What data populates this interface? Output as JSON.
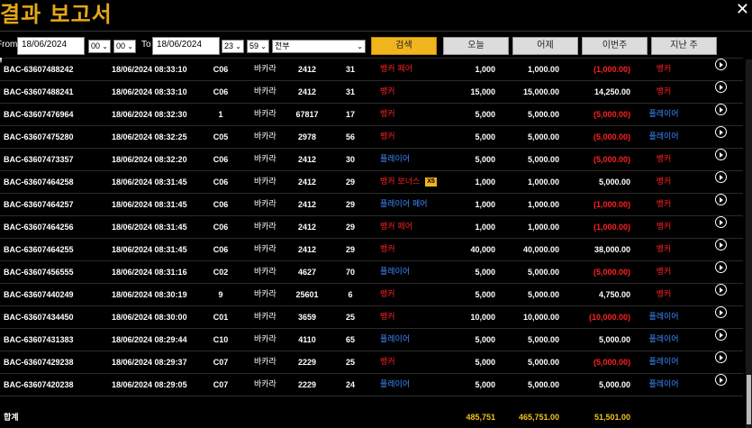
{
  "window": {
    "title": "결과 보고서",
    "close_glyph": "✕"
  },
  "filter": {
    "from_label": "From",
    "from_date": "18/06/2024",
    "from_hour": "00",
    "from_min": "00",
    "to_label": "To",
    "to_date": "18/06/2024",
    "to_hour": "23",
    "to_min": "59",
    "game_select": "전부",
    "buttons": {
      "search": "검색",
      "today": "오늘",
      "yesterday": "어제",
      "this_week": "이번주",
      "last_week": "지난 주"
    }
  },
  "rows": [
    {
      "id": "BAC-63607488242",
      "date": "18/06/2024 08:33:10",
      "table": "C06",
      "game": "바카라",
      "round": "2412",
      "seq": "31",
      "bet": "뱅커 페어",
      "bet_color": "red",
      "amount": "1,000",
      "valid": "1,000.00",
      "win": "(1,000.00)",
      "win_color": "red",
      "result": "뱅커",
      "result_color": "red"
    },
    {
      "id": "BAC-63607488241",
      "date": "18/06/2024 08:33:10",
      "table": "C06",
      "game": "바카라",
      "round": "2412",
      "seq": "31",
      "bet": "뱅커",
      "bet_color": "red",
      "amount": "15,000",
      "valid": "15,000.00",
      "win": "14,250.00",
      "win_color": "white",
      "result": "뱅커",
      "result_color": "red"
    },
    {
      "id": "BAC-63607476964",
      "date": "18/06/2024 08:32:30",
      "table": "1",
      "game": "바카라",
      "round": "67817",
      "seq": "17",
      "bet": "뱅커",
      "bet_color": "red",
      "amount": "5,000",
      "valid": "5,000.00",
      "win": "(5,000.00)",
      "win_color": "red",
      "result": "플레이어",
      "result_color": "blue"
    },
    {
      "id": "BAC-63607475280",
      "date": "18/06/2024 08:32:25",
      "table": "C05",
      "game": "바카라",
      "round": "2978",
      "seq": "56",
      "bet": "뱅커",
      "bet_color": "red",
      "amount": "5,000",
      "valid": "5,000.00",
      "win": "(5,000.00)",
      "win_color": "red",
      "result": "플레이어",
      "result_color": "blue"
    },
    {
      "id": "BAC-63607473357",
      "date": "18/06/2024 08:32:20",
      "table": "C06",
      "game": "바카라",
      "round": "2412",
      "seq": "30",
      "bet": "플레이어",
      "bet_color": "blue",
      "amount": "5,000",
      "valid": "5,000.00",
      "win": "(5,000.00)",
      "win_color": "red",
      "result": "뱅커",
      "result_color": "red"
    },
    {
      "id": "BAC-63607464258",
      "date": "18/06/2024 08:31:45",
      "table": "C06",
      "game": "바카라",
      "round": "2412",
      "seq": "29",
      "bet": "뱅커 보너스",
      "bet_color": "red",
      "badge": "X5",
      "amount": "1,000",
      "valid": "1,000.00",
      "win": "5,000.00",
      "win_color": "white",
      "result": "뱅커",
      "result_color": "red"
    },
    {
      "id": "BAC-63607464257",
      "date": "18/06/2024 08:31:45",
      "table": "C06",
      "game": "바카라",
      "round": "2412",
      "seq": "29",
      "bet": "플레이어 페어",
      "bet_color": "blue",
      "amount": "1,000",
      "valid": "1,000.00",
      "win": "(1,000.00)",
      "win_color": "red",
      "result": "뱅커",
      "result_color": "red"
    },
    {
      "id": "BAC-63607464256",
      "date": "18/06/2024 08:31:45",
      "table": "C06",
      "game": "바카라",
      "round": "2412",
      "seq": "29",
      "bet": "뱅커 페어",
      "bet_color": "red",
      "amount": "1,000",
      "valid": "1,000.00",
      "win": "(1,000.00)",
      "win_color": "red",
      "result": "뱅커",
      "result_color": "red"
    },
    {
      "id": "BAC-63607464255",
      "date": "18/06/2024 08:31:45",
      "table": "C06",
      "game": "바카라",
      "round": "2412",
      "seq": "29",
      "bet": "뱅커",
      "bet_color": "red",
      "amount": "40,000",
      "valid": "40,000.00",
      "win": "38,000.00",
      "win_color": "white",
      "result": "뱅커",
      "result_color": "red"
    },
    {
      "id": "BAC-63607456555",
      "date": "18/06/2024 08:31:16",
      "table": "C02",
      "game": "바카라",
      "round": "4627",
      "seq": "70",
      "bet": "플레이어",
      "bet_color": "blue",
      "amount": "5,000",
      "valid": "5,000.00",
      "win": "(5,000.00)",
      "win_color": "red",
      "result": "뱅커",
      "result_color": "red"
    },
    {
      "id": "BAC-63607440249",
      "date": "18/06/2024 08:30:19",
      "table": "9",
      "game": "바카라",
      "round": "25601",
      "seq": "6",
      "bet": "뱅커",
      "bet_color": "red",
      "amount": "5,000",
      "valid": "5,000.00",
      "win": "4,750.00",
      "win_color": "white",
      "result": "뱅커",
      "result_color": "red"
    },
    {
      "id": "BAC-63607434450",
      "date": "18/06/2024 08:30:00",
      "table": "C01",
      "game": "바카라",
      "round": "3659",
      "seq": "25",
      "bet": "뱅커",
      "bet_color": "red",
      "amount": "10,000",
      "valid": "10,000.00",
      "win": "(10,000.00)",
      "win_color": "red",
      "result": "플레이어",
      "result_color": "blue"
    },
    {
      "id": "BAC-63607431383",
      "date": "18/06/2024 08:29:44",
      "table": "C10",
      "game": "바카라",
      "round": "4110",
      "seq": "65",
      "bet": "플레이어",
      "bet_color": "blue",
      "amount": "5,000",
      "valid": "5,000.00",
      "win": "5,000.00",
      "win_color": "white",
      "result": "플레이어",
      "result_color": "blue"
    },
    {
      "id": "BAC-63607429238",
      "date": "18/06/2024 08:29:37",
      "table": "C07",
      "game": "바카라",
      "round": "2229",
      "seq": "25",
      "bet": "뱅커",
      "bet_color": "red",
      "amount": "5,000",
      "valid": "5,000.00",
      "win": "(5,000.00)",
      "win_color": "red",
      "result": "플레이어",
      "result_color": "blue"
    },
    {
      "id": "BAC-63607420238",
      "date": "18/06/2024 08:29:05",
      "table": "C07",
      "game": "바카라",
      "round": "2229",
      "seq": "24",
      "bet": "플레이어",
      "bet_color": "blue",
      "amount": "5,000",
      "valid": "5,000.00",
      "win": "5,000.00",
      "win_color": "white",
      "result": "플레이어",
      "result_color": "blue"
    }
  ],
  "totals": {
    "label": "합계",
    "amount": "485,751",
    "valid": "465,751.00",
    "win": "51,501.00"
  },
  "colors": {
    "accent": "#f0b41c",
    "title": "#e6a817",
    "red": "#ff2020",
    "blue": "#3b8bff",
    "total": "#f0c419"
  },
  "icons": {
    "row_action": "play-circle-icon",
    "close": "close-icon",
    "dropdown": "chevron-down-icon"
  }
}
